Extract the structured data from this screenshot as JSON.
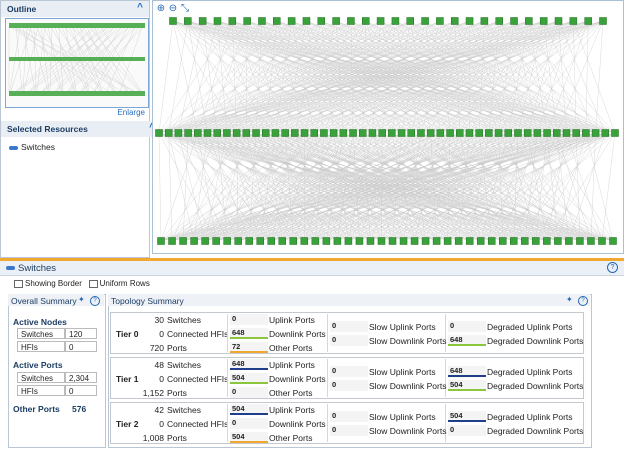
{
  "outline": {
    "title": "Outline",
    "enlarge": "Enlarge"
  },
  "selected_resources": {
    "title": "Selected Resources",
    "items": [
      {
        "label": "Switches"
      }
    ]
  },
  "graph_toolbar": {
    "zoom_in": "⊕",
    "zoom_out": "⊖",
    "fit": "⤡"
  },
  "switches_panel": {
    "title": "Switches",
    "options": {
      "showing_border": "Showing Border",
      "uniform_rows": "Uniform Rows"
    }
  },
  "overall_summary": {
    "title": "Overall Summary",
    "active_nodes": {
      "title": "Active Nodes",
      "switches_label": "Switches",
      "switches": "120",
      "hfis_label": "HFIs",
      "hfis": "0"
    },
    "active_ports": {
      "title": "Active Ports",
      "switches_label": "Switches",
      "switches": "2,304",
      "hfis_label": "HFIs",
      "hfis": "0"
    },
    "other_ports": {
      "label": "Other Ports",
      "value": "576"
    }
  },
  "topology_summary": {
    "title": "Topology Summary",
    "labels": {
      "switches": "Switches",
      "connected_hfis": "Connected HFIs",
      "ports": "Ports",
      "uplink": "Uplink Ports",
      "downlink": "Downlink Ports",
      "other": "Other Ports",
      "slow_uplink": "Slow Uplink Ports",
      "slow_downlink": "Slow Downlink Ports",
      "deg_uplink": "Degraded Uplink Ports",
      "deg_downlink": "Degraded Downlink Ports"
    },
    "tiers": [
      {
        "name": "Tier 0",
        "switches": "30",
        "connected_hfis": "0",
        "ports": "720",
        "uplink": "0",
        "downlink": "648",
        "other": "72",
        "slow_uplink": "0",
        "slow_downlink": "0",
        "deg_uplink": "0",
        "deg_downlink": "648"
      },
      {
        "name": "Tier 1",
        "switches": "48",
        "connected_hfis": "0",
        "ports": "1,152",
        "uplink": "648",
        "downlink": "504",
        "other": "0",
        "slow_uplink": "0",
        "slow_downlink": "0",
        "deg_uplink": "648",
        "deg_downlink": "504"
      },
      {
        "name": "Tier 2",
        "switches": "42",
        "connected_hfis": "0",
        "ports": "1,008",
        "uplink": "504",
        "downlink": "0",
        "other": "504",
        "slow_uplink": "0",
        "slow_downlink": "0",
        "deg_uplink": "504",
        "deg_downlink": "0"
      }
    ]
  },
  "colors": {
    "node": "#3aa23a",
    "accent": "#f0a830",
    "uplink_bar": "#1f3f8a",
    "downlink_bar": "#8cc63f",
    "other_bar": "#f0a830"
  }
}
